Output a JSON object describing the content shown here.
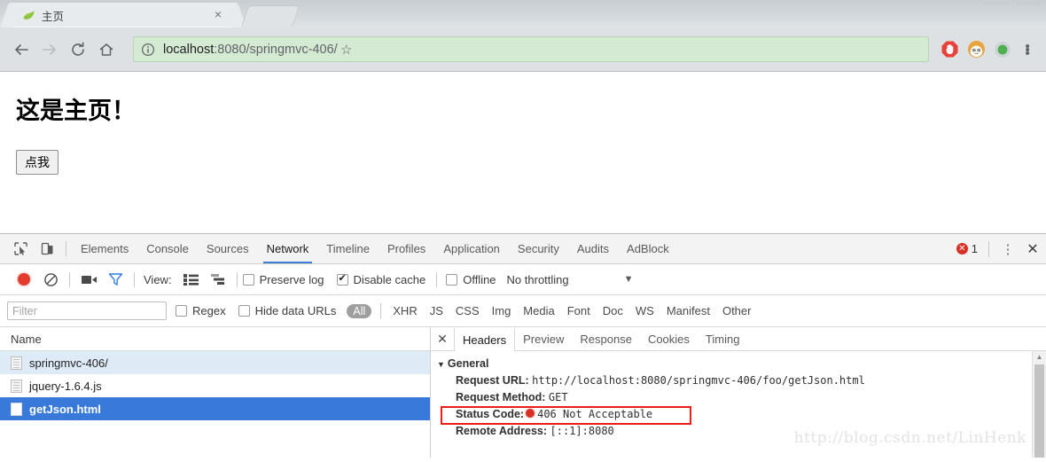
{
  "browser": {
    "tab": {
      "title": "主页",
      "favicon": "spring-leaf-icon",
      "close": "×"
    },
    "nav": {
      "back": "←",
      "forward": "→",
      "reload": "⟳",
      "home": "⌂"
    },
    "omnibox": {
      "security_icon": "info-circle-icon",
      "url_host": "localhost",
      "url_path": ":8080/springmvc-406/",
      "star": "☆",
      "bg_color": "#d5ead2"
    },
    "extensions": [
      "adblock-hand-icon",
      "avatar-icon",
      "green-circle-icon"
    ],
    "menu": "⋮"
  },
  "page": {
    "heading": "这是主页！",
    "button_label": "点我"
  },
  "devtools": {
    "left_icons": [
      "inspect-element-icon",
      "device-toolbar-icon"
    ],
    "tabs": [
      {
        "label": "Elements",
        "active": false
      },
      {
        "label": "Console",
        "active": false
      },
      {
        "label": "Sources",
        "active": false
      },
      {
        "label": "Network",
        "active": true
      },
      {
        "label": "Timeline",
        "active": false
      },
      {
        "label": "Profiles",
        "active": false
      },
      {
        "label": "Application",
        "active": false
      },
      {
        "label": "Security",
        "active": false
      },
      {
        "label": "Audits",
        "active": false
      },
      {
        "label": "AdBlock",
        "active": false
      }
    ],
    "error_count": "1",
    "more_menu": "⋮",
    "close": "✕",
    "network_toolbar": {
      "record_title": "record-button",
      "clear_title": "clear-button",
      "camera_title": "screenshot-button",
      "filter_title": "filter-button",
      "view_label": "View:",
      "preserve_log": {
        "label": "Preserve log",
        "checked": false
      },
      "disable_cache": {
        "label": "Disable cache",
        "checked": true
      },
      "offline": {
        "label": "Offline",
        "checked": false
      },
      "throttling": {
        "value": "No throttling",
        "caret": "▼"
      }
    },
    "filter_bar": {
      "placeholder": "Filter",
      "value": "",
      "regex": {
        "label": "Regex",
        "checked": false
      },
      "hide_data_urls": {
        "label": "Hide data URLs",
        "checked": false
      },
      "all_pill": "All",
      "types": [
        "XHR",
        "JS",
        "CSS",
        "Img",
        "Media",
        "Font",
        "Doc",
        "WS",
        "Manifest",
        "Other"
      ]
    },
    "requests": {
      "column_header": "Name",
      "rows": [
        {
          "name": "springmvc-406/",
          "state": "hover",
          "icon": "doc-icon"
        },
        {
          "name": "jquery-1.6.4.js",
          "state": "normal",
          "icon": "doc-icon"
        },
        {
          "name": "getJson.html",
          "state": "selected",
          "icon": "blank-doc-icon"
        }
      ]
    },
    "detail": {
      "close": "✕",
      "tabs": [
        {
          "label": "Headers",
          "active": true
        },
        {
          "label": "Preview",
          "active": false
        },
        {
          "label": "Response",
          "active": false
        },
        {
          "label": "Cookies",
          "active": false
        },
        {
          "label": "Timing",
          "active": false
        }
      ],
      "general": {
        "section_title": "General",
        "triangle": "▼",
        "rows": [
          {
            "key": "Request URL:",
            "value": "http://localhost:8080/springmvc-406/foo/getJson.html"
          },
          {
            "key": "Request Method:",
            "value": "GET"
          },
          {
            "key": "Status Code:",
            "value": "406 Not Acceptable",
            "status_dot": true,
            "highlighted": true
          },
          {
            "key": "Remote Address:",
            "value": "[::1]:8080"
          }
        ]
      },
      "highlight_color": "#ee1c19",
      "watermark": "http://blog.csdn.net/LinHenk"
    }
  }
}
